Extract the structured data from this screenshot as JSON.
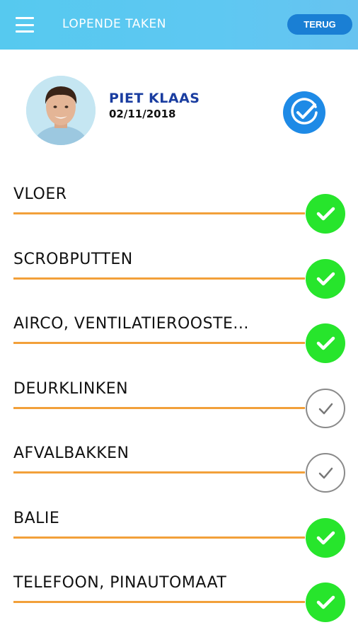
{
  "header": {
    "title": "LOPENDE TAKEN",
    "back_label": "TERUG"
  },
  "user": {
    "name": "PIET KLAAS",
    "date": "02/11/2018"
  },
  "colors": {
    "header": "#5ec8f2",
    "back_button": "#1a7fd4",
    "name": "#1a3da0",
    "line": "#f2a03a",
    "done": "#27e52c",
    "confirm": "#1e8ae6"
  },
  "tasks": [
    {
      "label": "VLOER",
      "status": "done",
      "icon": "check-circle-icon"
    },
    {
      "label": "SCROBPUTTEN",
      "status": "done",
      "icon": "check-circle-icon"
    },
    {
      "label": "AIRCO, VENTILATIEROOSTE...",
      "status": "done",
      "icon": "check-circle-icon"
    },
    {
      "label": "DEURKLINKEN",
      "status": "open",
      "icon": "check-outline-icon"
    },
    {
      "label": "AFVALBAKKEN",
      "status": "open",
      "icon": "check-outline-icon"
    },
    {
      "label": "BALIE",
      "status": "done",
      "icon": "check-circle-icon"
    },
    {
      "label": "TELEFOON, PINAUTOMAAT",
      "status": "done",
      "icon": "check-circle-icon"
    }
  ]
}
